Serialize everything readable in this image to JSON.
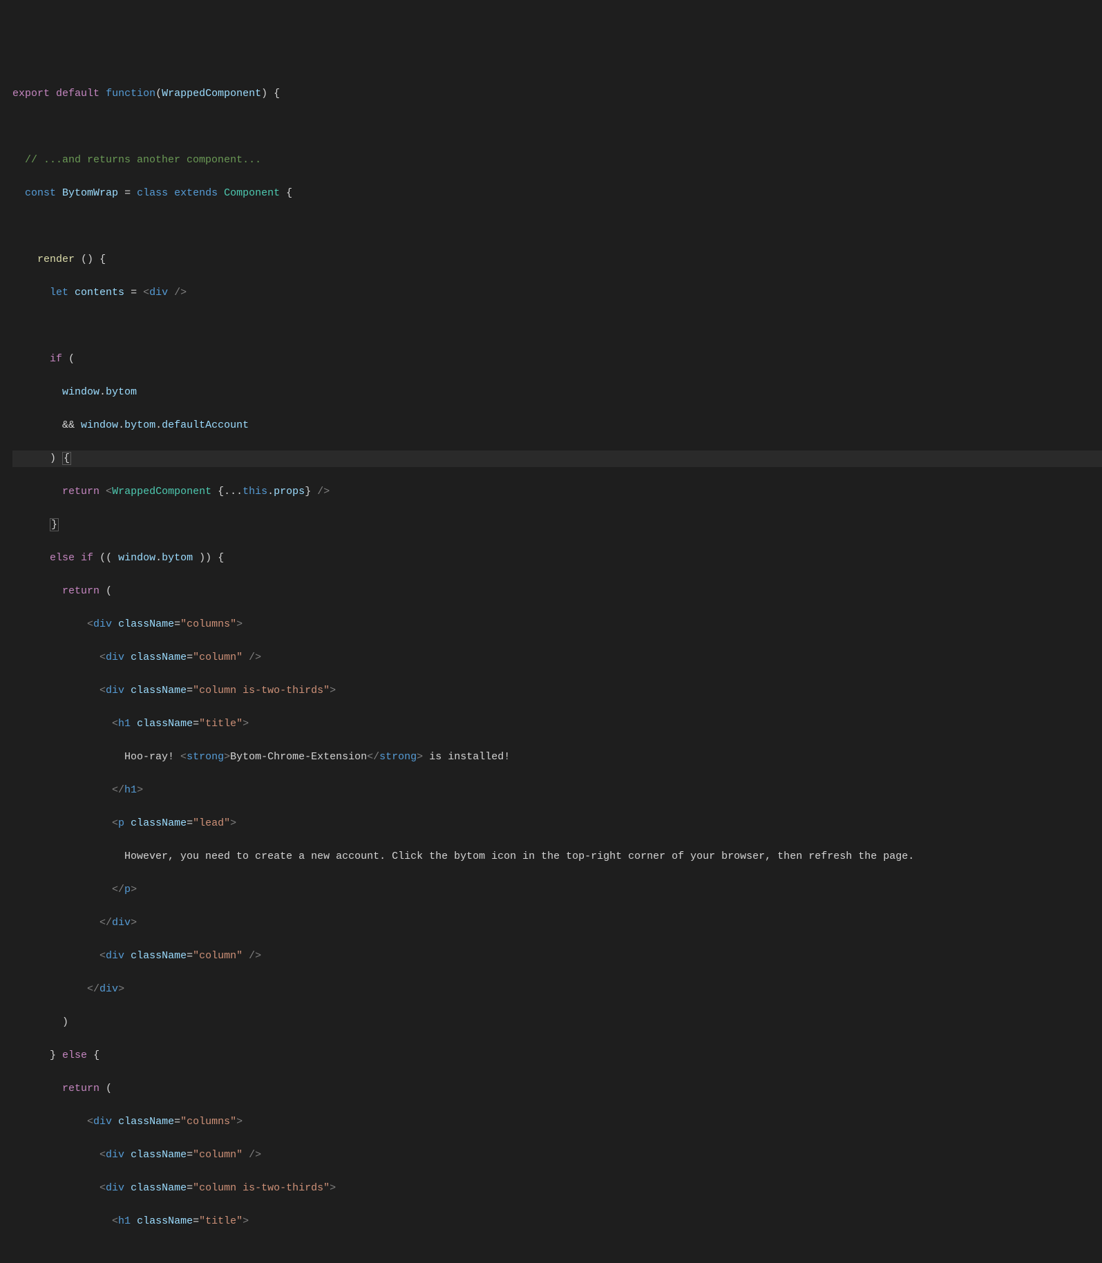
{
  "code": {
    "l1_export": "export",
    "l1_default": "default",
    "l1_function": "function",
    "l1_param": "WrappedComponent",
    "l3_comment": "// ...and returns another component...",
    "l4_const": "const",
    "l4_name": "BytomWrap",
    "l4_eq": " = ",
    "l4_class": "class",
    "l4_extends": "extends",
    "l4_Component": "Component",
    "l6_render": "render",
    "l7_let": "let",
    "l7_contents": "contents",
    "l7_eq": " = ",
    "l7_div": "div",
    "l9_if": "if",
    "l10_window": "window",
    "l10_bytom": "bytom",
    "l11_and": "&&",
    "l11_window": "window",
    "l11_bytom": "bytom",
    "l11_default": "defaultAccount",
    "l13_return": "return",
    "l13_Wrapped": "WrappedComponent",
    "l13_spread": "...",
    "l13_this": "this",
    "l13_props": "props",
    "l15_else": "else",
    "l15_if": "if",
    "l15_window": "window",
    "l15_bytom": "bytom",
    "l16_return": "return",
    "l17_div": "div",
    "l17_cn": "className",
    "l17_columns": "\"columns\"",
    "l18_div": "div",
    "l18_cn": "className",
    "l18_column": "\"column\"",
    "l19_div": "div",
    "l19_cn": "className",
    "l19_val": "\"column is-two-thirds\"",
    "l20_h1": "h1",
    "l20_cn": "className",
    "l20_val": "\"title\"",
    "l21_t1": "Hoo-ray! ",
    "l21_strong": "strong",
    "l21_t2": "Bytom-Chrome-Extension",
    "l21_strongc": "strong",
    "l21_t3": " is installed!",
    "l22_h1": "h1",
    "l23_p": "p",
    "l23_cn": "className",
    "l23_val": "\"lead\"",
    "l24_text": "However, you need to create a new account. Click the bytom icon in the top-right corner of your browser, then refresh the page.",
    "l25_p": "p",
    "l26_div": "div",
    "l27_div": "div",
    "l27_cn": "className",
    "l27_val": "\"column\"",
    "l28_div": "div",
    "l30_else": "else",
    "l31_return": "return",
    "l32_div": "div",
    "l32_cn": "className",
    "l32_val": "\"columns\"",
    "l33_div": "div",
    "l33_cn": "className",
    "l33_val": "\"column\"",
    "l34_div": "div",
    "l34_cn": "className",
    "l34_val": "\"column is-two-thirds\"",
    "l35_h1": "h1",
    "l35_cn": "className",
    "l35_val": "\"title\""
  }
}
